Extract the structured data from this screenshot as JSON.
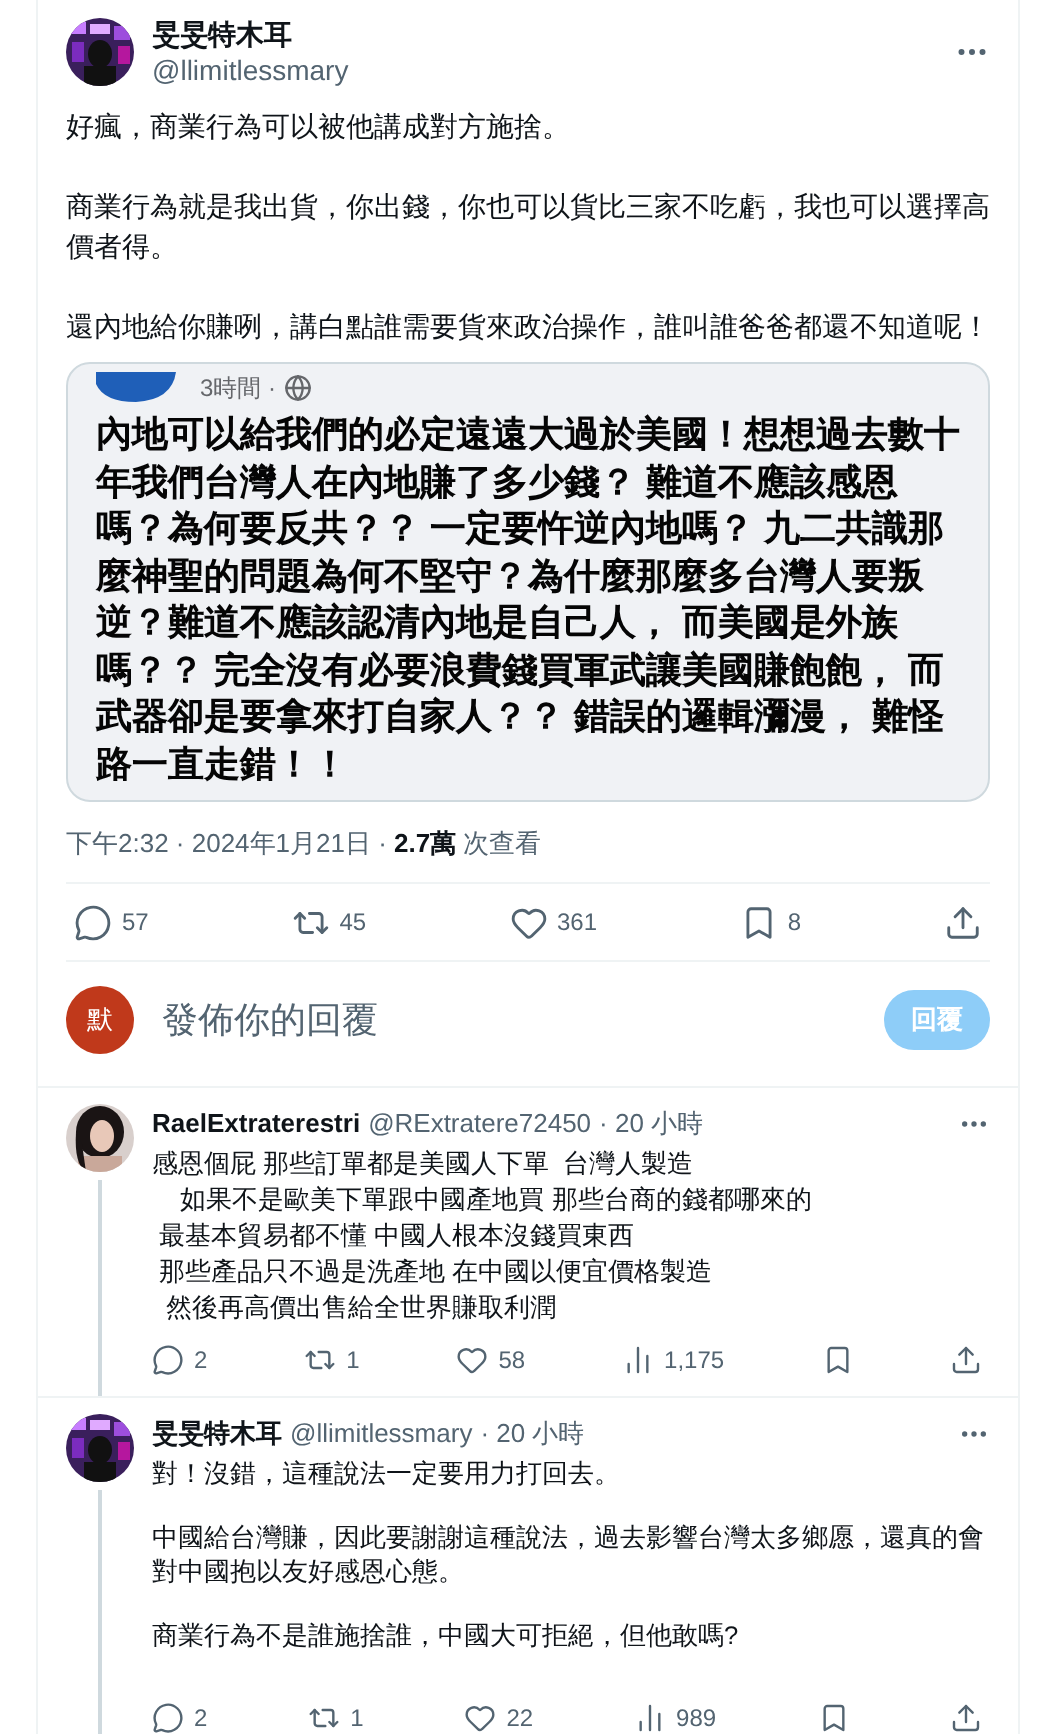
{
  "post": {
    "author": "旻旻特木耳",
    "handle": "@llimitlessmary",
    "paragraphs": [
      "好瘋，商業行為可以被他講成對方施捨。",
      "商業行為就是我出貨，你出錢，你也可以貨比三家不吃虧，我也可以選擇高價者得。",
      "還內地給你賺咧，講白點誰需要貨來政治操作，誰叫誰爸爸都還不知道呢！"
    ],
    "quote": {
      "time": "3時間 ·",
      "text": "內地可以給我們的必定遠遠大過於美國！想想過去數十年我們台灣人在內地賺了多少錢？ 難道不應該感恩嗎？為何要反共？？ 一定要忤逆內地嗎？ 九二共識那麼神聖的問題為何不堅守？為什麼那麼多台灣人要叛逆？難道不應該認清內地是自己人， 而美國是外族嗎？？ 完全沒有必要浪費錢買軍武讓美國賺飽飽， 而武器卻是要拿來打自家人？？ 錯誤的邏輯瀰漫， 難怪路一直走錯！！"
    },
    "timestamp": "下午2:32 · 2024年1月21日 · ",
    "views": "2.7萬",
    "views_label": " 次查看",
    "actions": [
      {
        "kind": "reply",
        "count": "57"
      },
      {
        "kind": "repost",
        "count": "45"
      },
      {
        "kind": "like",
        "count": "361"
      },
      {
        "kind": "bookmark",
        "count": "8"
      },
      {
        "kind": "share"
      }
    ]
  },
  "compose": {
    "avatar": "默",
    "placeholder": "發佈你的回覆",
    "button": "回覆"
  },
  "replies": [
    {
      "author": "RaelExtraterestri",
      "handle": "@RExtratere72450",
      "time": "· 20 小時",
      "text": [
        "感恩個屁 那些訂單都是美國人下單  台灣人製造",
        "    如果不是歐美下單跟中國產地買 那些台商的錢都哪來的",
        " 最基本貿易都不懂 中國人根本沒錢買東西",
        " 那些產品只不過是洗產地 在中國以便宜價格製造",
        "  然後再高價出售給全世界賺取利潤"
      ],
      "actions": [
        {
          "kind": "reply",
          "count": "2"
        },
        {
          "kind": "repost",
          "count": "1"
        },
        {
          "kind": "like",
          "count": "58"
        },
        {
          "kind": "views",
          "count": "1,175"
        },
        {
          "kind": "bookmark"
        },
        {
          "kind": "share"
        }
      ]
    },
    {
      "author": "旻旻特木耳",
      "handle": "@llimitlessmary",
      "time": "· 20 小時",
      "paragraphs": [
        "對！沒錯，這種說法一定要用力打回去。",
        "中國給台灣賺，因此要謝謝這種說法，過去影響台灣太多鄉愿，還真的會對中國抱以友好感恩心態。",
        "商業行為不是誰施捨誰，中國大可拒絕，但他敢嗎?"
      ],
      "actions": [
        {
          "kind": "reply",
          "count": "2"
        },
        {
          "kind": "repost",
          "count": "1"
        },
        {
          "kind": "like",
          "count": "22"
        },
        {
          "kind": "views",
          "count": "989"
        },
        {
          "kind": "bookmark"
        },
        {
          "kind": "share"
        }
      ]
    }
  ]
}
